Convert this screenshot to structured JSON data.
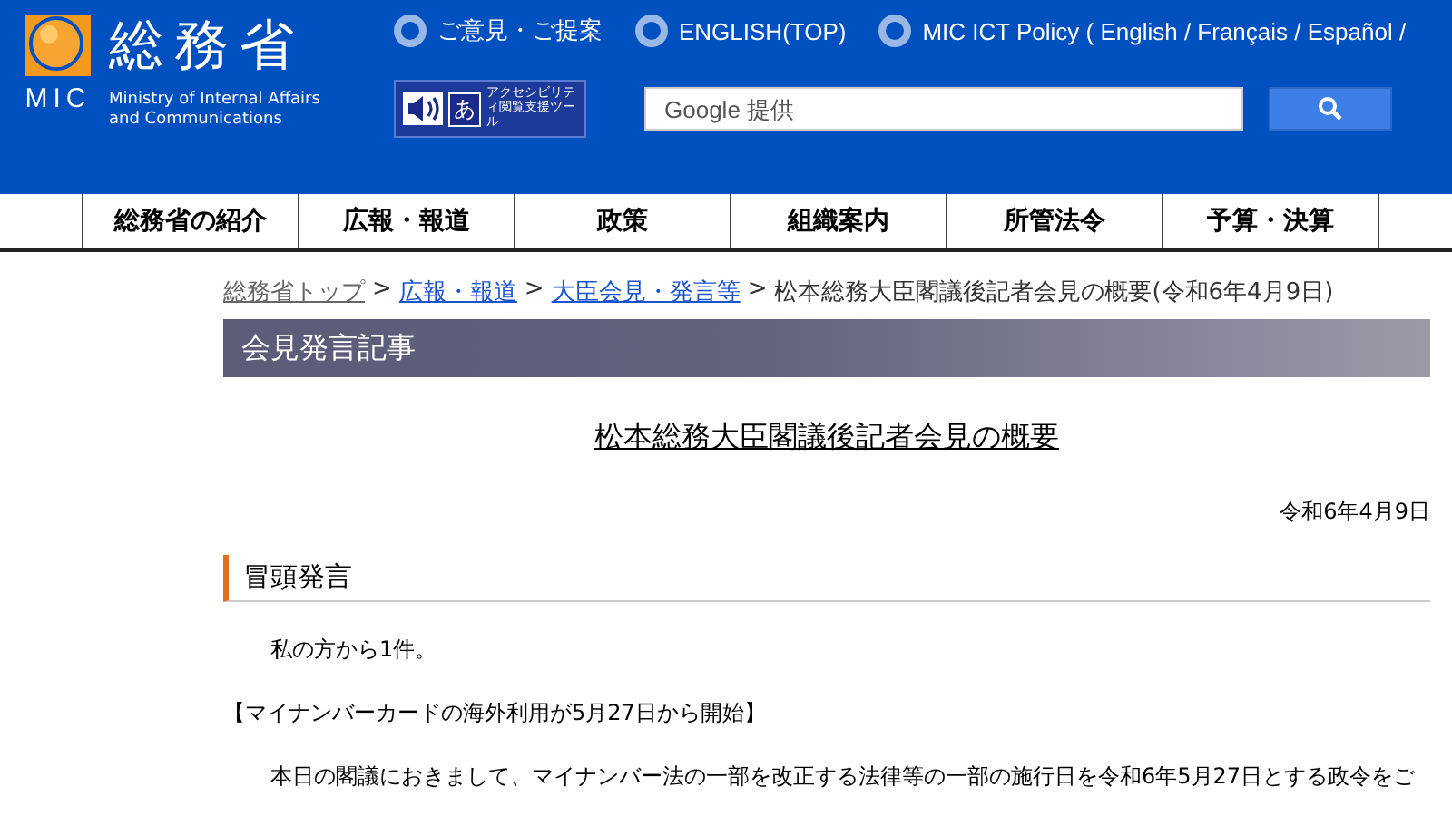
{
  "header": {
    "logo_text": "MIC",
    "ministry_name": "総務省",
    "ministry_name_en": "Ministry of Internal Affairs and Communications",
    "top_links": [
      "ご意見・ご提案",
      "ENGLISH(TOP)",
      "MIC ICT Policy ( English / Français / Español /"
    ],
    "accessibility_tool": {
      "icon_char": "あ",
      "label": "アクセシビリティ閲覧支援ツール"
    },
    "search": {
      "placeholder": "Google 提供"
    }
  },
  "nav": {
    "items": [
      "総務省の紹介",
      "広報・報道",
      "政策",
      "組織案内",
      "所管法令",
      "予算・決算"
    ]
  },
  "breadcrumb": {
    "links": [
      "総務省トップ",
      "広報・報道",
      "大臣会見・発言等"
    ],
    "separator": ">",
    "current": "松本総務大臣閣議後記者会見の概要(令和6年4月9日)"
  },
  "section_banner": "会見発言記事",
  "article": {
    "title": "松本総務大臣閣議後記者会見の概要",
    "date": "令和6年4月9日",
    "heading": "冒頭発言",
    "paragraphs": [
      "私の方から1件。",
      "【マイナンバーカードの海外利用が5月27日から開始】",
      "本日の閣議におきまして、マイナンバー法の一部を改正する法律等の一部の施行日を令和6年5月27日とする政令をご"
    ]
  }
}
